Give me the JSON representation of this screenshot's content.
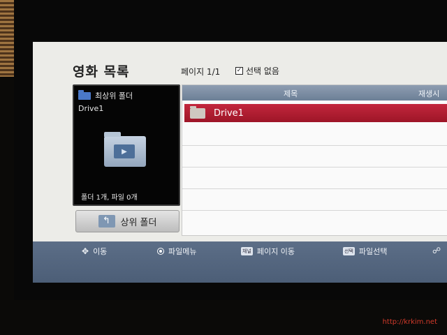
{
  "header": {
    "title": "영화 목록",
    "page_indicator": "페이지 1/1",
    "selection_status": "선택 없음"
  },
  "preview": {
    "header_label": "최상위 폴더",
    "name": "Drive1",
    "summary": "폴더 1개, 파일 0개"
  },
  "parent_button": {
    "label": "상위 폴더"
  },
  "list": {
    "columns": {
      "title": "제목",
      "playtime": "재생시"
    },
    "items": [
      {
        "name": "Drive1",
        "type": "folder",
        "selected": true
      }
    ]
  },
  "bottom_bar": {
    "move": "이동",
    "file_menu": "파일메뉴",
    "channel_key": "채널",
    "page_move": "페이지 이동",
    "select_key": "선택",
    "file_select": "파일선택"
  },
  "watermark": "http://krkim.net",
  "colors": {
    "accent_red": "#b01e32",
    "bar_blue": "#56687f",
    "header_blue": "#7a8ca3",
    "background": "#ecece8"
  }
}
